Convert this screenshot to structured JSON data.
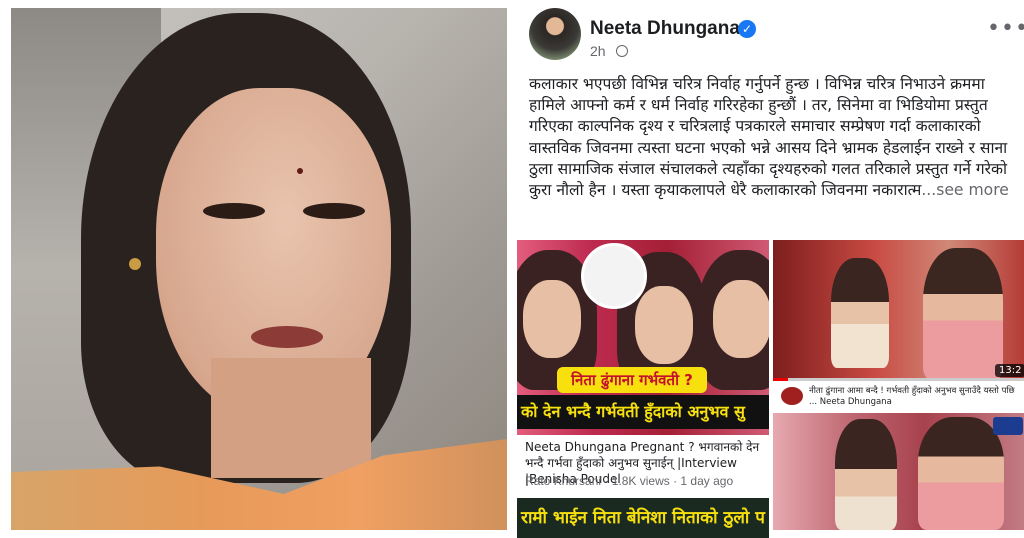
{
  "post": {
    "author": "Neeta Dhungana",
    "time": "2h",
    "text": "कलाकार भएपछी विभिन्न चरित्र निर्वाह गर्नुपर्ने हुन्छ । विभिन्न चरित्र निभाउने क्रममा हामिले आफ्नो कर्म र धर्म निर्वाह गरिरहेका हुन्छौं । तर, सिनेमा वा भिडियोमा प्रस्तुत गरिएका काल्पनिक दृश्य र चरित्रलाई पत्रकारले समाचार सम्प्रेषण गर्दा कलाकारको वास्तविक जिवनमा त्यस्ता घटना भएको भन्ने आसय दिने भ्रामक हेडलाईन राख्ने र साना ठुला सामाजिक संजाल संचालकले त्यहाँका दृश्यहरुको गलत तरिकाले प्रस्तुत गर्ने गरेको कुरा नौलो हैन । यस्ता कृयाकलापले धेरै कलाकारको जिवनमा नकारात्म",
    "see_more": "...see more"
  },
  "media": {
    "main": {
      "banner_yellow": "निता ढुंगाना गर्भवती ?",
      "banner_black": "को देन भन्दै गर्भवती हुँदाको अनुभव सु",
      "title": "Neeta Dhungana Pregnant ? भगवानको देन भन्दै गर्भवा हुँदाको अनुभव सुनाईन् |Interview |Benisha Poudel",
      "channel": "Rato Khursani",
      "views": "1.8K views",
      "age": "1 day ago",
      "strip": "रामी भाईन निता बेनिशा निताको ठुलो प"
    },
    "top_right": {
      "duration": "13:2",
      "progress": 0.06,
      "caption": "नीता ढुंगाना आमा बन्दै ! गर्भवती हुँदाको अनुभव सुनाउँदै यस्तो पछि ... Neeta Dhungana"
    },
    "bottom_right": {}
  },
  "colors": {
    "verified": "#1877f2",
    "text": "#1c1e21",
    "secondary": "#65676b",
    "banner_yellow": "#f7e00e"
  }
}
